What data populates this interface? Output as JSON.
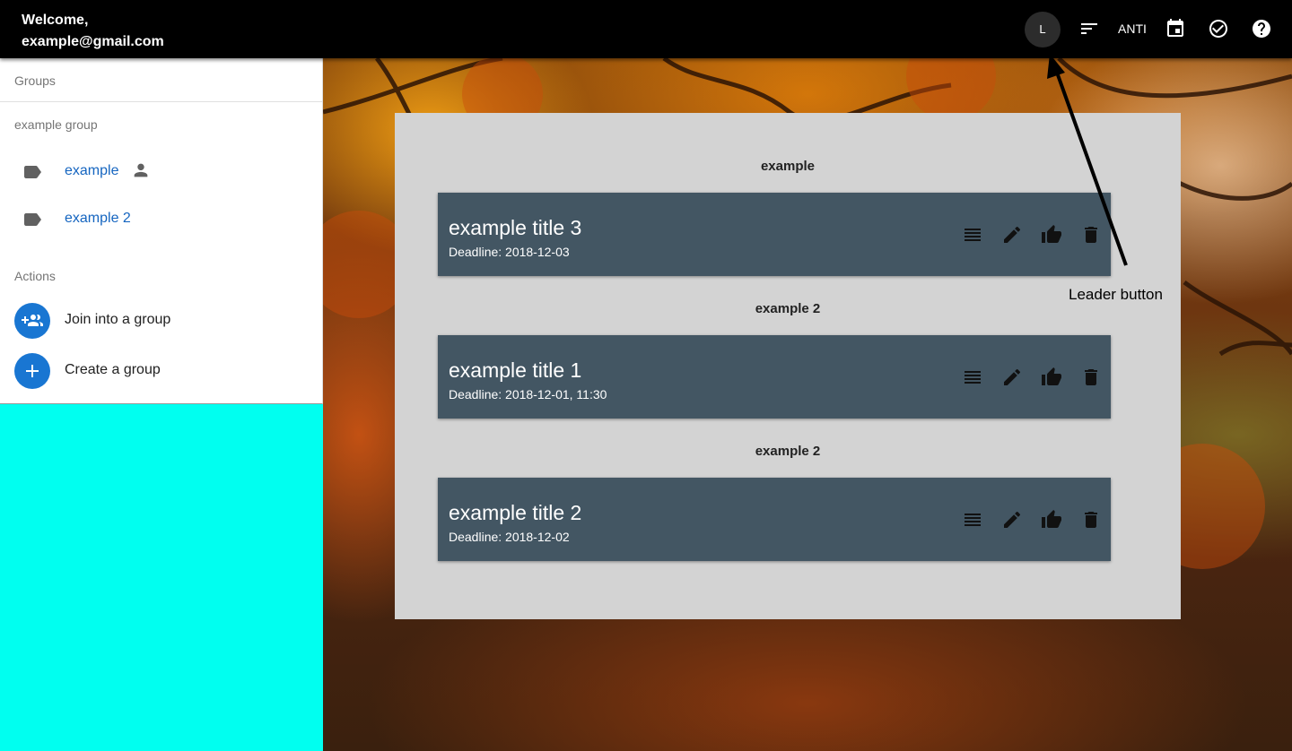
{
  "header": {
    "welcome_line1": "Welcome,",
    "welcome_line2": "example@gmail.com",
    "leader_label": "L",
    "anti_label": "ANTI",
    "icons": [
      "sort-icon",
      "calendar-icon",
      "check-circle-icon",
      "help-icon"
    ]
  },
  "sidebar": {
    "groups_header": "Groups",
    "group_section": "example group",
    "groups": [
      {
        "label": "example",
        "icon": "label-icon",
        "owner_icon": "person-icon"
      },
      {
        "label": "example 2",
        "icon": "label-icon"
      }
    ],
    "actions_header": "Actions",
    "actions": [
      {
        "label": "Join into a group",
        "icon": "group-add-icon"
      },
      {
        "label": "Create a group",
        "icon": "add-icon"
      }
    ],
    "accent_color": "#1976d2",
    "background_color": "#00fff0"
  },
  "main": {
    "sections": [
      {
        "group": "example",
        "task": {
          "title": "example title 3",
          "deadline": "Deadline: 2018-12-03"
        }
      },
      {
        "group": "example 2",
        "task": {
          "title": "example title 1",
          "deadline": "Deadline: 2018-12-01, 11:30"
        }
      },
      {
        "group": "example 2",
        "task": {
          "title": "example title 2",
          "deadline": "Deadline: 2018-12-02"
        }
      }
    ],
    "task_actions": [
      "list-icon",
      "edit-icon",
      "thumb-up-icon",
      "delete-icon"
    ],
    "task_color": "#435663"
  },
  "annotation": {
    "text": "Leader button"
  }
}
